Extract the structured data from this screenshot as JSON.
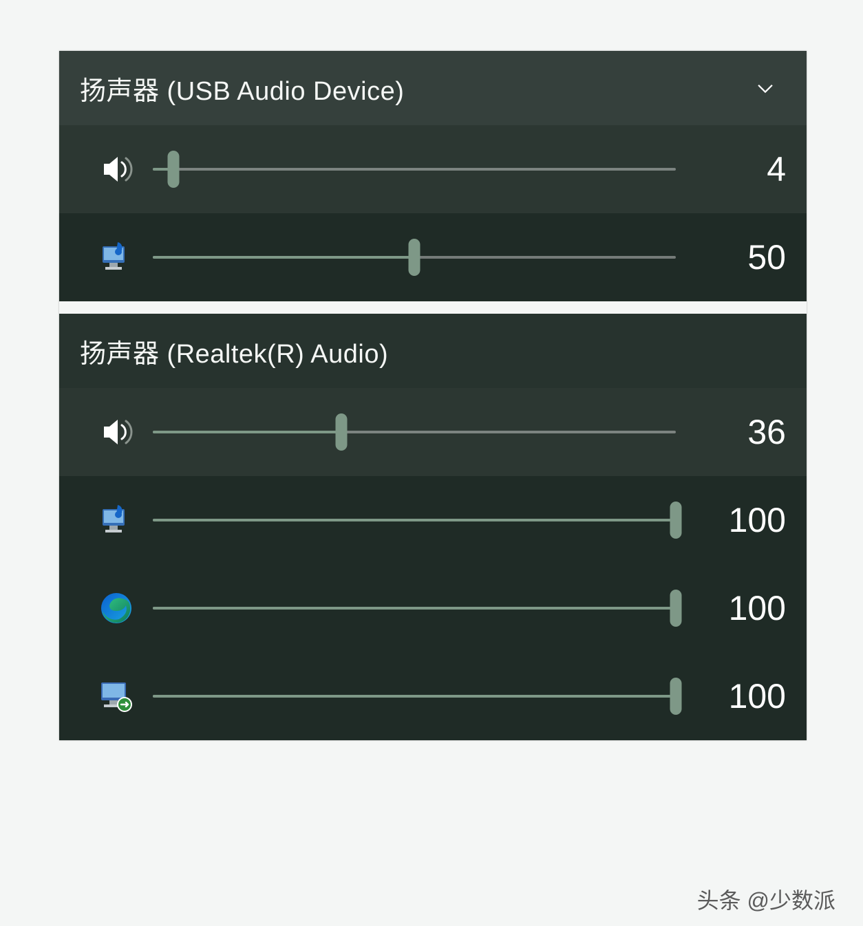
{
  "devices": [
    {
      "id": "usb",
      "title": "扬声器 (USB Audio Device)",
      "has_chevron": true,
      "master": {
        "icon": "speaker",
        "value": 4
      },
      "apps": [
        {
          "icon": "system-sounds",
          "value": 50
        }
      ]
    },
    {
      "id": "realtek",
      "title": "扬声器 (Realtek(R) Audio)",
      "has_chevron": false,
      "master": {
        "icon": "speaker",
        "value": 36
      },
      "apps": [
        {
          "icon": "system-sounds",
          "value": 100
        },
        {
          "icon": "edge",
          "value": 100
        },
        {
          "icon": "rdp",
          "value": 100
        }
      ]
    }
  ],
  "watermark": "头条 @少数派",
  "colors": {
    "panel_bg": "#1f2b26",
    "accent": "#7e9887",
    "track": "rgba(255,255,255,0.38)",
    "page_bg": "#f4f6f5"
  }
}
